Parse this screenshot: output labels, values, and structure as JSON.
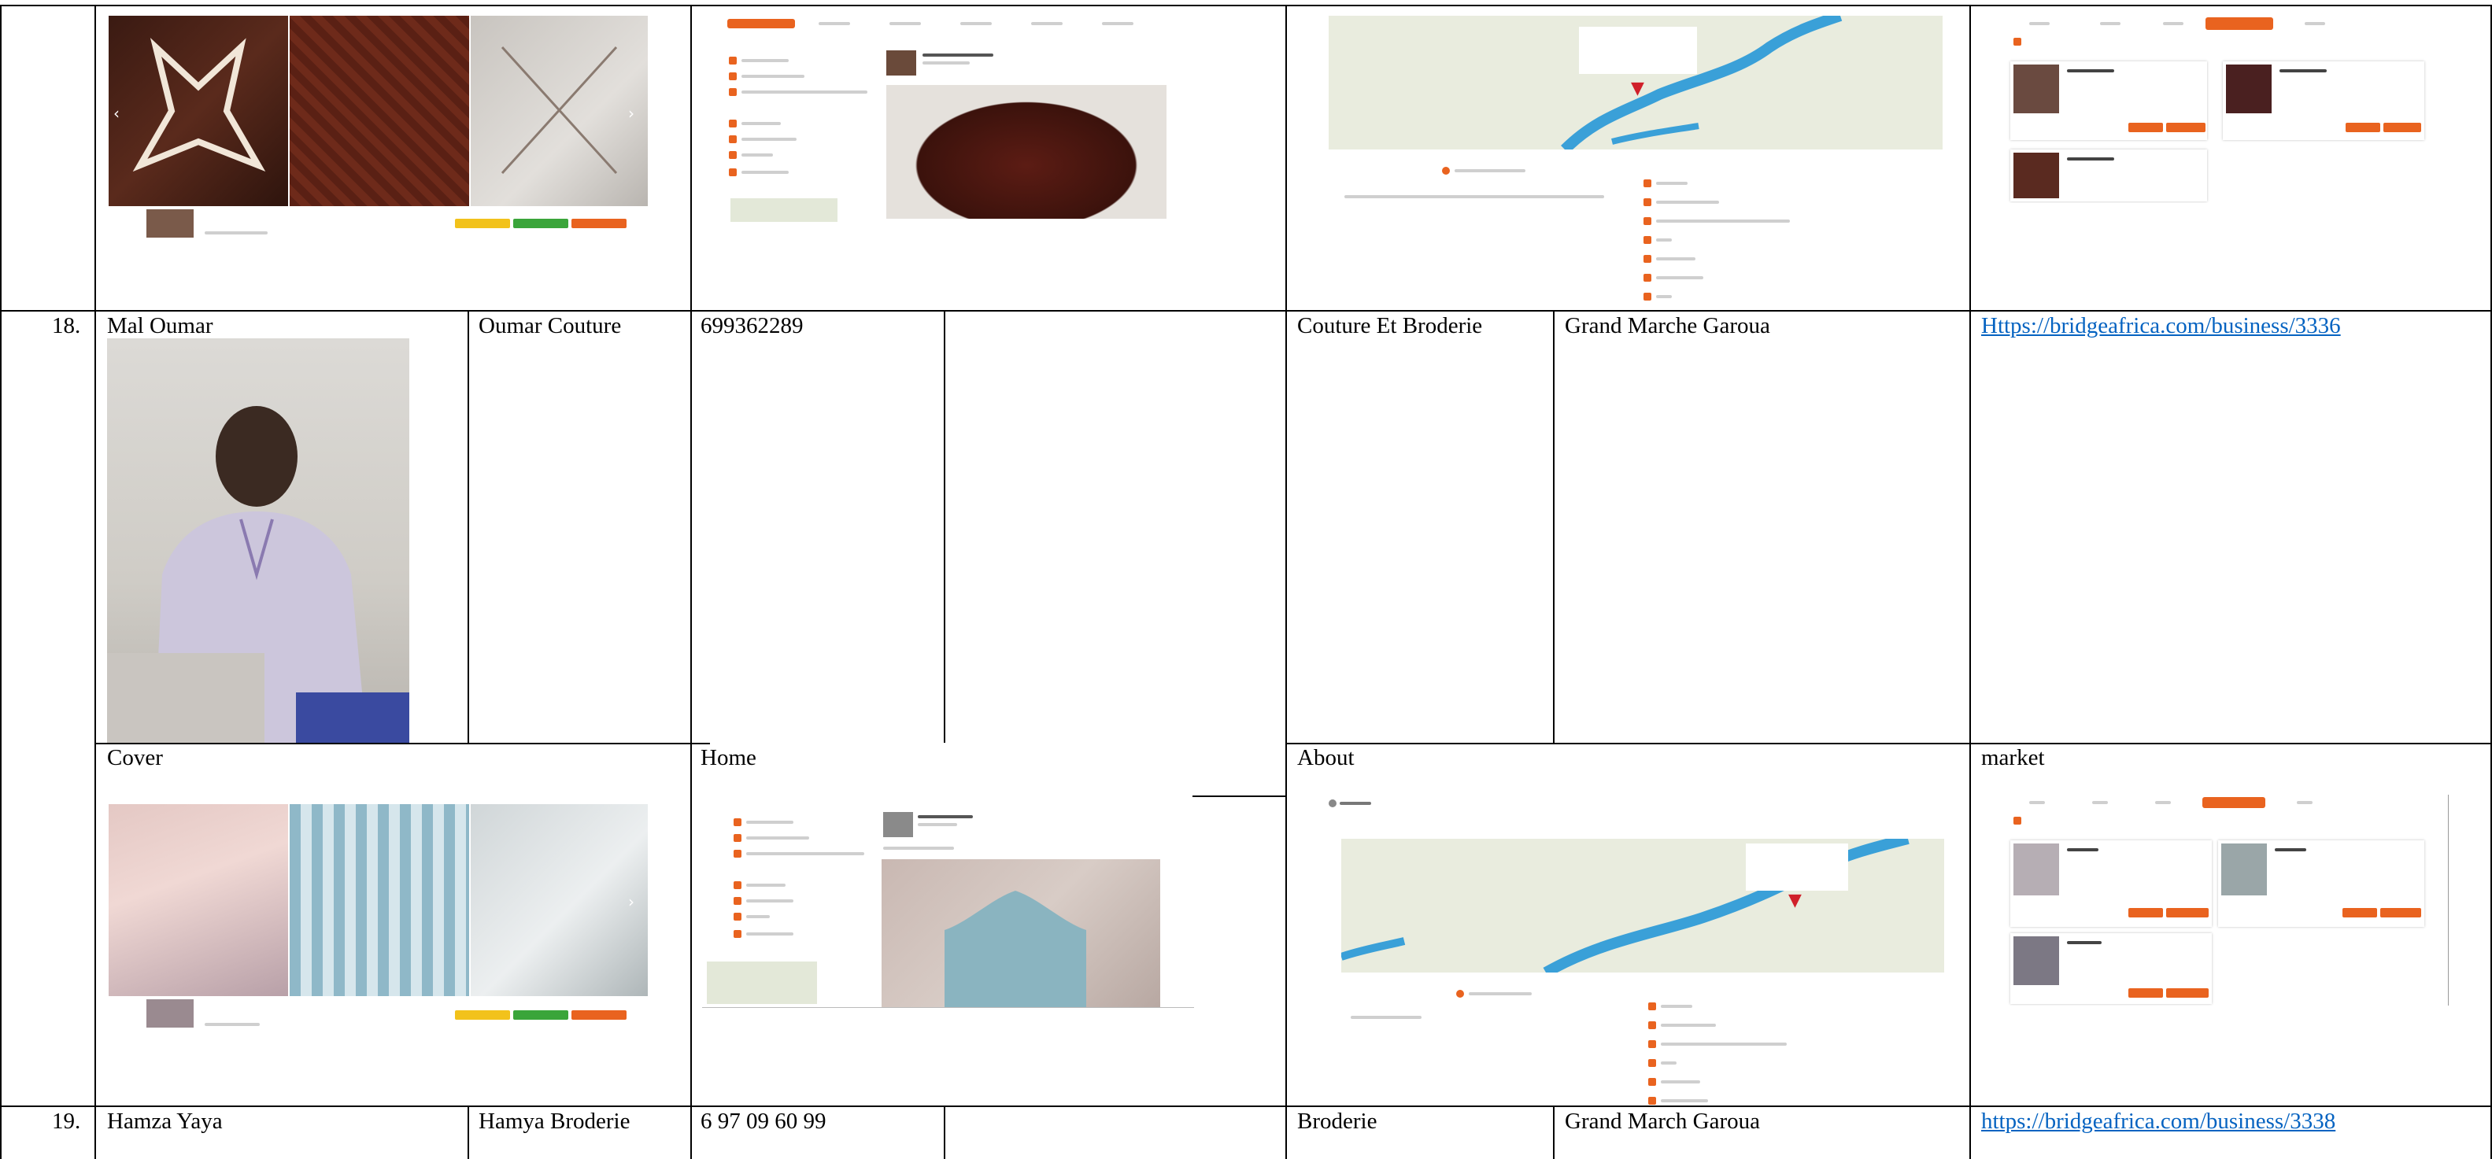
{
  "rows": [
    {
      "number": "18.",
      "owner": "Mal Oumar",
      "business": "Oumar Couture",
      "phone": "699362289",
      "category": "Couture Et Broderie",
      "location": "Grand Marche Garoua",
      "link": "Https://bridgeafrica.com/business/3336",
      "section_labels": {
        "cover": "Cover",
        "home": "Home",
        "about": "About",
        "market": "market"
      }
    },
    {
      "number": "19.",
      "owner": "Hamza Yaya",
      "business": "Hamya Broderie",
      "phone": "6 97 09 60 99",
      "category": "Broderie",
      "location": "Grand March Garoua",
      "link": "https://bridgeafrica.com/business/3338"
    }
  ],
  "colors": {
    "accent": "#e9631f",
    "link": "#0563c1",
    "map_water": "#3aa0d8",
    "pin": "#d0202a"
  },
  "icons": [
    "map-pin-icon",
    "chevron-left-icon",
    "chevron-right-icon",
    "about-icon"
  ]
}
